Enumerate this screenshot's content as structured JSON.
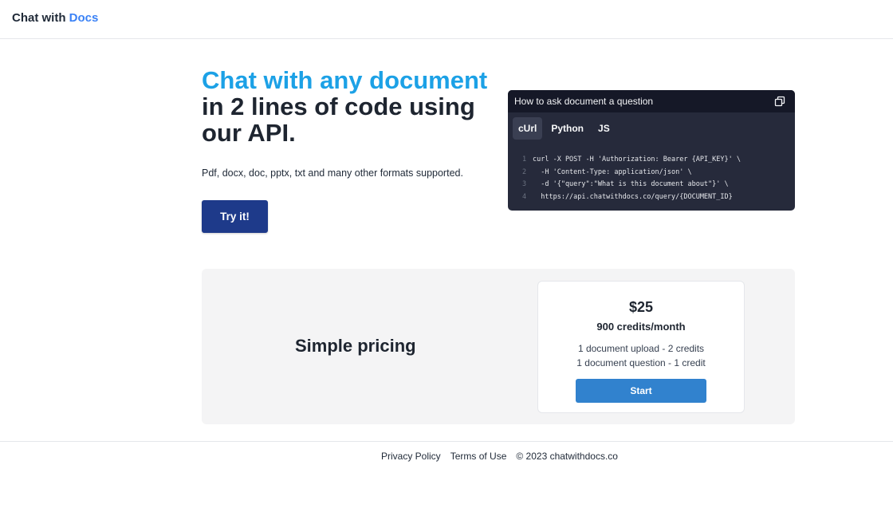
{
  "header": {
    "brand_prefix": "Chat with",
    "brand_accent": "Docs"
  },
  "hero": {
    "title_highlight": "Chat with any document",
    "title_rest": "in 2 lines of code using our API.",
    "subtitle": "Pdf, docx, doc, pptx, txt and many other formats supported.",
    "cta_label": "Try it!"
  },
  "code_example": {
    "title": "How to ask document a question",
    "copy_icon": "copy-icon",
    "tabs": [
      {
        "label": "cUrl",
        "active": true
      },
      {
        "label": "Python",
        "active": false
      },
      {
        "label": "JS",
        "active": false
      }
    ],
    "lines": [
      {
        "n": "1",
        "text": "curl -X POST -H 'Authorization: Bearer {API_KEY}' \\"
      },
      {
        "n": "2",
        "text": "  -H 'Content-Type: application/json' \\"
      },
      {
        "n": "3",
        "text": "  -d '{\"query\":\"What is this document about\"}' \\"
      },
      {
        "n": "4",
        "text": "  https://api.chatwithdocs.co/query/{DOCUMENT_ID}"
      }
    ]
  },
  "pricing": {
    "section_title": "Simple pricing",
    "price": "$25",
    "credits": "900 credits/month",
    "feature_upload": "1 document upload - 2 credits",
    "feature_question": "1 document question - 1 credit",
    "cta_label": "Start"
  },
  "footer": {
    "privacy": "Privacy Policy",
    "terms": "Terms of Use",
    "copyright": "© 2023 chatwithdocs.co"
  },
  "colors": {
    "brand_accent": "#3b82f6",
    "hero_highlight": "#1ca1e6",
    "primary_button": "#1e3a8a",
    "start_button": "#3182ce",
    "code_bg": "#262a3b"
  }
}
